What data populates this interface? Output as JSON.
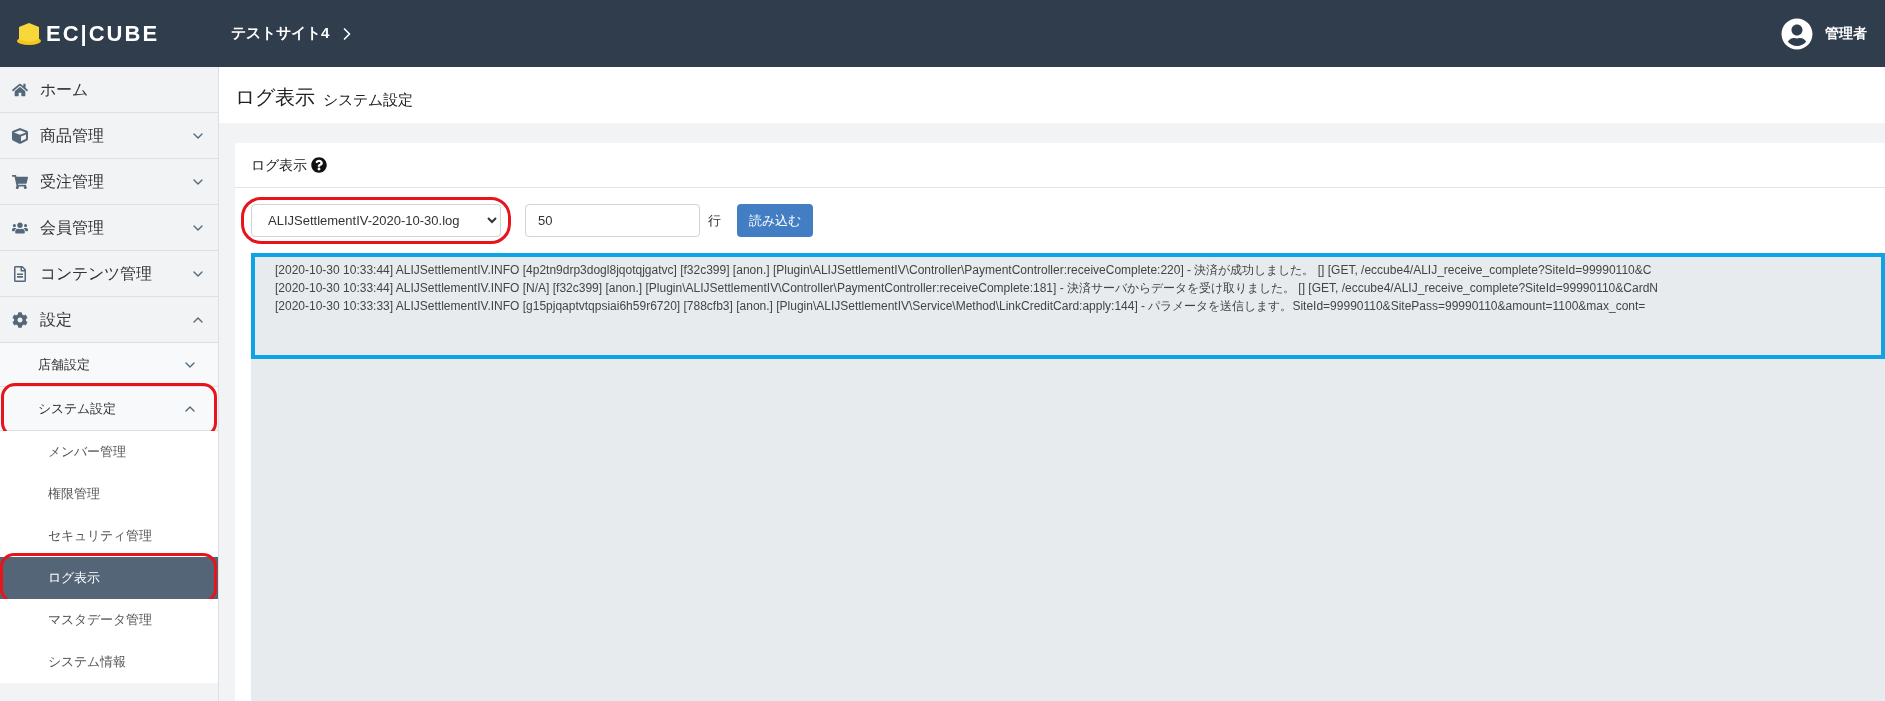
{
  "header": {
    "logo": "EC|CUBE",
    "site": "テストサイト4",
    "user": "管理者"
  },
  "sidebar": {
    "items": [
      {
        "label": "ホーム",
        "has_children": false
      },
      {
        "label": "商品管理",
        "expanded": false,
        "has_children": true
      },
      {
        "label": "受注管理",
        "expanded": false,
        "has_children": true
      },
      {
        "label": "会員管理",
        "expanded": false,
        "has_children": true
      },
      {
        "label": "コンテンツ管理",
        "expanded": false,
        "has_children": true
      },
      {
        "label": "設定",
        "expanded": true,
        "has_children": true,
        "children": [
          {
            "label": "店舗設定",
            "expanded": false,
            "circled": false
          },
          {
            "label": "システム設定",
            "expanded": true,
            "circled": true,
            "children": [
              {
                "label": "メンバー管理",
                "selected": false,
                "circled": false
              },
              {
                "label": "権限管理",
                "selected": false,
                "circled": false
              },
              {
                "label": "セキュリティ管理",
                "selected": false,
                "circled": false
              },
              {
                "label": "ログ表示",
                "selected": true,
                "circled": true
              },
              {
                "label": "マスタデータ管理",
                "selected": false,
                "circled": false
              },
              {
                "label": "システム情報",
                "selected": false,
                "circled": false
              }
            ]
          }
        ]
      }
    ]
  },
  "page": {
    "title": "ログ表示",
    "subtitle": "システム設定"
  },
  "card": {
    "title": "ログ表示",
    "file_select": {
      "value": "ALIJSettlementIV-2020-10-30.log",
      "circled": true
    },
    "lines_input": {
      "value": "50"
    },
    "lines_unit": "行",
    "load_button": "読み込む",
    "log_focused": true,
    "log_lines": [
      "[2020-10-30 10:33:44] ALIJSettlementIV.INFO [4p2tn9drp3dogl8jqotqjgatvc] [f32c399] [anon.] [Plugin\\ALIJSettlementIV\\Controller\\PaymentController:receiveComplete:220] - 決済が成功しました。 [] [GET, /eccube4/ALIJ_receive_complete?SiteId=99990110&C",
      "[2020-10-30 10:33:44] ALIJSettlementIV.INFO [N/A] [f32c399] [anon.] [Plugin\\ALIJSettlementIV\\Controller\\PaymentController:receiveComplete:181] - 決済サーバからデータを受け取りました。 [] [GET, /eccube4/ALIJ_receive_complete?SiteId=99990110&CardN",
      "[2020-10-30 10:33:33] ALIJSettlementIV.INFO [g15pjqaptvtqpsiai6h59r6720] [788cfb3] [anon.] [Plugin\\ALIJSettlementIV\\Service\\Method\\LinkCreditCard:apply:144] - パラメータを送信します。SiteId=99990110&SitePass=99990110&amount=1100&max_cont="
    ]
  }
}
